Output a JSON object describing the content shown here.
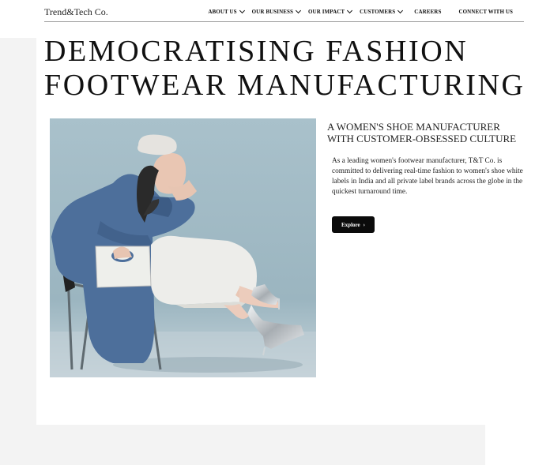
{
  "header": {
    "logo_text": "Trend&Tech Co.",
    "nav": [
      {
        "label": "ABOUT US",
        "has_dropdown": true
      },
      {
        "label": "OUR BUSINESS",
        "has_dropdown": true
      },
      {
        "label": "OUR IMPACT",
        "has_dropdown": true
      },
      {
        "label": "CUSTOMERS",
        "has_dropdown": true
      },
      {
        "label": "CAREERS",
        "has_dropdown": false
      },
      {
        "label": "CONNECT WITH US",
        "has_dropdown": false
      }
    ]
  },
  "hero": {
    "title_line1": "DEMOCRATISING FASHION",
    "title_line2": "FOOTWEAR MANUFACTURING",
    "image_icon": "fashion-model-photo",
    "sub_heading_line1": "A WOMEN'S SHOE MANUFACTURER",
    "sub_heading_line2": "WITH CUSTOMER-OBSESSED CULTURE",
    "body": "As a leading women's footwear manufacturer, T&T Co. is committed to delivering real-time fashion to women's shoe white labels in India and all private label brands across the globe in the quickest turnaround time.",
    "explore_label": "Explore",
    "explore_arrow": "›"
  },
  "colors": {
    "background": "#ffffff",
    "side_panel": "#f3f3f3",
    "button": "#0b0b0b",
    "photo_backdrop": "#a6bfc9",
    "coat": "#4d6f9b"
  }
}
